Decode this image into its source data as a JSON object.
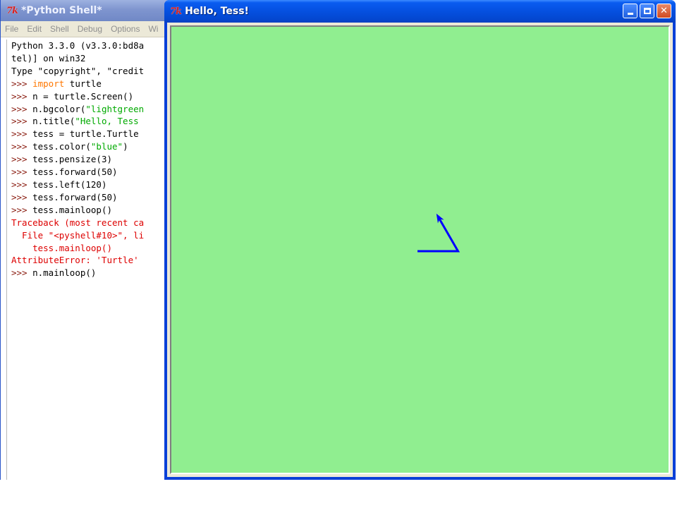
{
  "shell": {
    "title": "*Python Shell*",
    "logo": "7k",
    "menu": [
      "File",
      "Edit",
      "Shell",
      "Debug",
      "Options",
      "Wi"
    ],
    "lines": [
      [
        {
          "t": "Python 3.3.0 (v3.3.0:bd8a",
          "c": "plain"
        }
      ],
      [
        {
          "t": "tel)] on win32",
          "c": "plain"
        }
      ],
      [
        {
          "t": "Type \"copyright\", \"credit",
          "c": "plain"
        }
      ],
      [
        {
          "t": ">>> ",
          "c": "prompt"
        },
        {
          "t": "import",
          "c": "kw"
        },
        {
          "t": " turtle",
          "c": "plain"
        }
      ],
      [
        {
          "t": ">>> ",
          "c": "prompt"
        },
        {
          "t": "n = turtle.Screen()",
          "c": "plain"
        }
      ],
      [
        {
          "t": ">>> ",
          "c": "prompt"
        },
        {
          "t": "n.bgcolor(",
          "c": "plain"
        },
        {
          "t": "\"lightgreen",
          "c": "str"
        }
      ],
      [
        {
          "t": ">>> ",
          "c": "prompt"
        },
        {
          "t": "n.title(",
          "c": "plain"
        },
        {
          "t": "\"Hello, Tess",
          "c": "str"
        }
      ],
      [
        {
          "t": ">>> ",
          "c": "prompt"
        },
        {
          "t": "tess = turtle.Turtle",
          "c": "plain"
        }
      ],
      [
        {
          "t": ">>> ",
          "c": "prompt"
        },
        {
          "t": "tess.color(",
          "c": "plain"
        },
        {
          "t": "\"blue\"",
          "c": "str"
        },
        {
          "t": ")",
          "c": "plain"
        }
      ],
      [
        {
          "t": ">>> ",
          "c": "prompt"
        },
        {
          "t": "tess.pensize(3)",
          "c": "plain"
        }
      ],
      [
        {
          "t": ">>> ",
          "c": "prompt"
        },
        {
          "t": "tess.forward(50)",
          "c": "plain"
        }
      ],
      [
        {
          "t": ">>> ",
          "c": "prompt"
        },
        {
          "t": "tess.left(120)",
          "c": "plain"
        }
      ],
      [
        {
          "t": ">>> ",
          "c": "prompt"
        },
        {
          "t": "tess.forward(50)",
          "c": "plain"
        }
      ],
      [
        {
          "t": ">>> ",
          "c": "prompt"
        },
        {
          "t": "tess.mainloop()",
          "c": "plain"
        }
      ],
      [
        {
          "t": "Traceback (most recent ca",
          "c": "err"
        }
      ],
      [
        {
          "t": "  File \"<pyshell#10>\", li",
          "c": "err"
        }
      ],
      [
        {
          "t": "    tess.mainloop()",
          "c": "err"
        }
      ],
      [
        {
          "t": "AttributeError: 'Turtle' ",
          "c": "err"
        }
      ],
      [
        {
          "t": ">>> ",
          "c": "prompt"
        },
        {
          "t": "n.mainloop()",
          "c": "plain"
        }
      ]
    ]
  },
  "turtle_window": {
    "title": "Hello, Tess!",
    "logo": "7k",
    "bgcolor": "#90ee90",
    "pen_color": "#0000ff",
    "pen_size": 3,
    "moves": [
      {
        "cmd": "forward",
        "value": 50
      },
      {
        "cmd": "left",
        "value": 120
      },
      {
        "cmd": "forward",
        "value": 50
      }
    ],
    "buttons": {
      "minimize": "minimize",
      "maximize": "maximize",
      "close": "close"
    }
  },
  "colors": {
    "prompt": "#8a1c10",
    "keyword": "#ff7700",
    "string": "#00aa00",
    "error": "#dd0000"
  }
}
